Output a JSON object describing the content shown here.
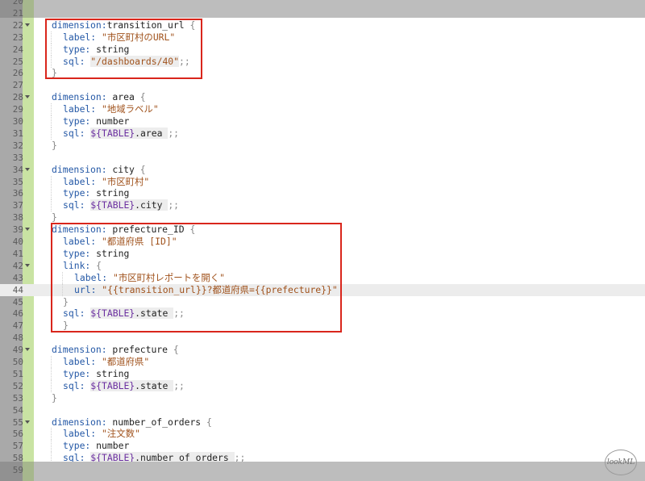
{
  "editor": {
    "lines": [
      {
        "n": "20",
        "fold": false,
        "indent": 1,
        "html": "<span class=\"p\">}</span>"
      },
      {
        "n": "21",
        "fold": false,
        "indent": 0,
        "html": ""
      },
      {
        "n": "22",
        "fold": true,
        "indent": 0,
        "html": "<span class=\"k\">dimension:</span>transition_url <span class=\"p\">{</span>"
      },
      {
        "n": "23",
        "fold": false,
        "indent": 1,
        "html": "<span class=\"k\">label:</span> <span class=\"s\">\"市区町村のURL\"</span>"
      },
      {
        "n": "24",
        "fold": false,
        "indent": 1,
        "html": "<span class=\"k\">type:</span> string"
      },
      {
        "n": "25",
        "fold": false,
        "indent": 1,
        "html": "<span class=\"k\">sql:</span> <span class=\"sqlbox\"><span class=\"s\">\"/dashboards/40\"</span></span><span class=\"p\">;;</span>"
      },
      {
        "n": "26",
        "fold": false,
        "indent": 0,
        "html": "<span class=\"p\">}</span>"
      },
      {
        "n": "27",
        "fold": false,
        "indent": 0,
        "html": ""
      },
      {
        "n": "28",
        "fold": true,
        "indent": 0,
        "html": "<span class=\"k\">dimension:</span> area <span class=\"p\">{</span>"
      },
      {
        "n": "29",
        "fold": false,
        "indent": 1,
        "html": "<span class=\"k\">label:</span> <span class=\"s\">\"地域ラベル\"</span>"
      },
      {
        "n": "30",
        "fold": false,
        "indent": 1,
        "html": "<span class=\"k\">type:</span> number"
      },
      {
        "n": "31",
        "fold": false,
        "indent": 1,
        "html": "<span class=\"k\">sql:</span> <span class=\"sqlbox\"><span class=\"v\">${TABLE}</span>.area </span><span class=\"p\">;;</span>"
      },
      {
        "n": "32",
        "fold": false,
        "indent": 0,
        "html": "<span class=\"p\">}</span>"
      },
      {
        "n": "33",
        "fold": false,
        "indent": 0,
        "html": ""
      },
      {
        "n": "34",
        "fold": true,
        "indent": 0,
        "html": "<span class=\"k\">dimension:</span> city <span class=\"p\">{</span>"
      },
      {
        "n": "35",
        "fold": false,
        "indent": 1,
        "html": "<span class=\"k\">label:</span> <span class=\"s\">\"市区町村\"</span>"
      },
      {
        "n": "36",
        "fold": false,
        "indent": 1,
        "html": "<span class=\"k\">type:</span> string"
      },
      {
        "n": "37",
        "fold": false,
        "indent": 1,
        "html": "<span class=\"k\">sql:</span> <span class=\"sqlbox\"><span class=\"v\">${TABLE}</span>.city </span><span class=\"p\">;;</span>"
      },
      {
        "n": "38",
        "fold": false,
        "indent": 0,
        "html": "<span class=\"p\">}</span>"
      },
      {
        "n": "39",
        "fold": true,
        "indent": 0,
        "html": "<span class=\"k\">dimension:</span> prefecture_ID <span class=\"p\">{</span>"
      },
      {
        "n": "40",
        "fold": false,
        "indent": 1,
        "html": "<span class=\"k\">label:</span> <span class=\"s\">\"都道府県 [ID]\"</span>"
      },
      {
        "n": "41",
        "fold": false,
        "indent": 1,
        "html": "<span class=\"k\">type:</span> string"
      },
      {
        "n": "42",
        "fold": true,
        "indent": 1,
        "html": "<span class=\"k\">link:</span> <span class=\"p\">{</span>"
      },
      {
        "n": "43",
        "fold": false,
        "indent": 2,
        "html": "<span class=\"k\">label:</span> <span class=\"s\">\"市区町村レポートを開く\"</span>"
      },
      {
        "n": "44",
        "fold": false,
        "indent": 2,
        "html": "<span class=\"k\">url:</span> <span class=\"s\">\"{{transition_url}}?都道府県={{prefecture}}\"</span>",
        "highlight": true
      },
      {
        "n": "45",
        "fold": false,
        "indent": 1,
        "html": "<span class=\"p\">}</span>"
      },
      {
        "n": "46",
        "fold": false,
        "indent": 1,
        "html": "<span class=\"k\">sql:</span> <span class=\"sqlbox\"><span class=\"v\">${TABLE}</span>.state </span><span class=\"p\">;;</span>"
      },
      {
        "n": "47",
        "fold": false,
        "indent": 1,
        "html": "<span class=\"p\">}</span>"
      },
      {
        "n": "48",
        "fold": false,
        "indent": 0,
        "html": ""
      },
      {
        "n": "49",
        "fold": true,
        "indent": 0,
        "html": "<span class=\"k\">dimension:</span> prefecture <span class=\"p\">{</span>"
      },
      {
        "n": "50",
        "fold": false,
        "indent": 1,
        "html": "<span class=\"k\">label:</span> <span class=\"s\">\"都道府県\"</span>"
      },
      {
        "n": "51",
        "fold": false,
        "indent": 1,
        "html": "<span class=\"k\">type:</span> string"
      },
      {
        "n": "52",
        "fold": false,
        "indent": 1,
        "html": "<span class=\"k\">sql:</span> <span class=\"sqlbox\"><span class=\"v\">${TABLE}</span>.state </span><span class=\"p\">;;</span>"
      },
      {
        "n": "53",
        "fold": false,
        "indent": 0,
        "html": "<span class=\"p\">}</span>"
      },
      {
        "n": "54",
        "fold": false,
        "indent": 0,
        "html": ""
      },
      {
        "n": "55",
        "fold": true,
        "indent": 0,
        "html": "<span class=\"k\">dimension:</span> number_of_orders <span class=\"p\">{</span>"
      },
      {
        "n": "56",
        "fold": false,
        "indent": 1,
        "html": "<span class=\"k\">label:</span> <span class=\"s\">\"注文数\"</span>"
      },
      {
        "n": "57",
        "fold": false,
        "indent": 1,
        "html": "<span class=\"k\">type:</span> number"
      },
      {
        "n": "58",
        "fold": false,
        "indent": 1,
        "html": "<span class=\"k\">sql:</span> <span class=\"sqlbox\"><span class=\"v\">${TABLE}</span>.number_of_orders </span><span class=\"p\">;;</span>"
      },
      {
        "n": "59",
        "fold": false,
        "indent": 0,
        "html": "<span class=\"p\">}</span>"
      }
    ]
  },
  "watermark": "lookML",
  "colors": {
    "keyword": "#2458a6",
    "string": "#a0521c",
    "variable": "#6b2fa0",
    "gutter": "#c9e3a3",
    "annotation": "#d9261c"
  }
}
